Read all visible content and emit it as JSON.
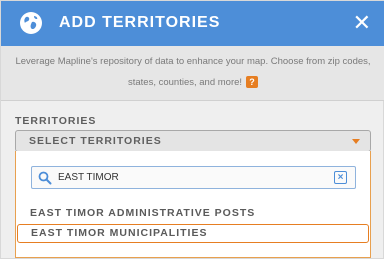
{
  "header": {
    "title": "ADD TERRITORIES",
    "close_label": "✕",
    "accent": "#4d8ed8"
  },
  "intro": {
    "line1": "Leverage Mapline's repository of data to enhance your map. Choose from zip codes,",
    "line2": "states, counties, and more!",
    "help_label": "?"
  },
  "territories": {
    "section_label": "TERRITORIES",
    "select_label": "SELECT TERRITORIES",
    "caret_color": "#e67e22"
  },
  "search": {
    "value": "EAST TIMOR",
    "placeholder": "",
    "clear_label": "×"
  },
  "options": [
    {
      "label": "EAST TIMOR ADMINISTRATIVE POSTS"
    },
    {
      "label": "EAST TIMOR MUNICIPALITIES",
      "highlighted": true
    }
  ]
}
